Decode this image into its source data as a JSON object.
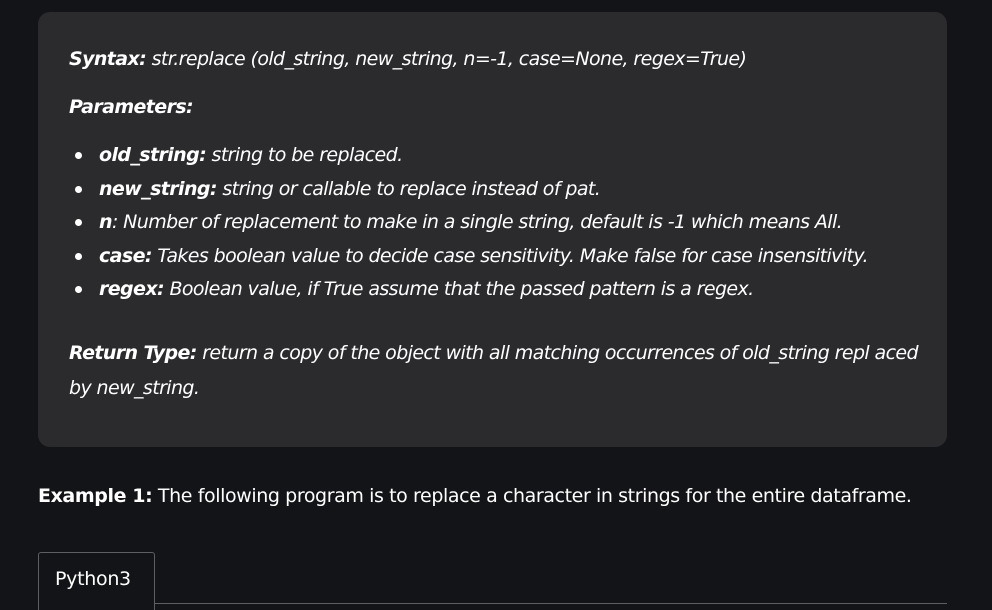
{
  "syntax": {
    "label": "Syntax:",
    "text": " str.replace (old_string, new_string, n=-1, case=None, regex=True)"
  },
  "parameters": {
    "heading": "Parameters:",
    "items": [
      {
        "name": "old_string:",
        "desc": " string to be replaced."
      },
      {
        "name": "new_string:",
        "desc": " string or callable to replace instead of pat."
      },
      {
        "name": "n",
        "desc": ": Number of replacement to make in a single string, default is -1 which means All."
      },
      {
        "name": "case:",
        "desc": " Takes boolean value to decide case sensitivity. Make false for case insensitivity."
      },
      {
        "name": "regex:",
        "desc": " Boolean value, if True assume that the passed pattern is a regex."
      }
    ]
  },
  "return_type": {
    "label": "Return Type:",
    "text": " return a copy of the object with all matching occurrences of old_string repl aced by new_string."
  },
  "example": {
    "label": "Example 1:",
    "text": " The following program is to replace a character in strings for the entire dataframe."
  },
  "code_tabs": [
    {
      "label": "Python3"
    }
  ]
}
